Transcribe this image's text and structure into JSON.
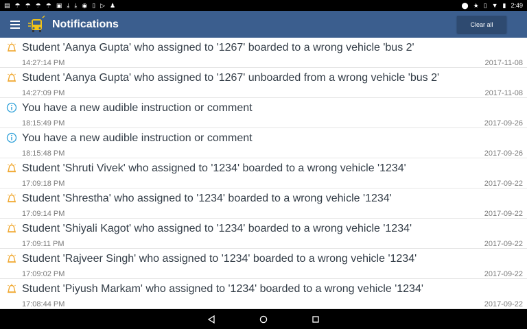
{
  "status_bar": {
    "time": "2:49",
    "left_icons": [
      "sms-icon",
      "weather-icon",
      "weather-icon",
      "weather-icon",
      "weather-icon",
      "image-icon",
      "download-icon",
      "download-icon",
      "nfc-icon",
      "sim-icon",
      "play-store-icon",
      "android-icon"
    ],
    "right_icons": [
      "location-icon",
      "star-icon",
      "vibrate-icon",
      "wifi-icon",
      "battery-icon"
    ]
  },
  "app_bar": {
    "title": "Notifications",
    "clear_label": "Clear all"
  },
  "colors": {
    "app_bar": "#3b5e8e",
    "button": "#2e4a70",
    "alert_icon": "#f0a830",
    "info_icon": "#2a9fd8",
    "message_text": "#333d47"
  },
  "notifications": [
    {
      "icon": "alert-icon",
      "message": "Student 'Aanya Gupta' who assigned to '1267' boarded to a wrong vehicle 'bus 2'",
      "time": "14:27:14 PM",
      "date": "2017-11-08"
    },
    {
      "icon": "alert-icon",
      "message": "Student 'Aanya Gupta' who assigned to '1267' unboarded from a wrong vehicle 'bus 2'",
      "time": "14:27:09 PM",
      "date": "2017-11-08"
    },
    {
      "icon": "info-icon",
      "message": "You have a new audible instruction or comment",
      "time": "18:15:49 PM",
      "date": "2017-09-26"
    },
    {
      "icon": "info-icon",
      "message": "You have a new audible instruction or comment",
      "time": "18:15:48 PM",
      "date": "2017-09-26"
    },
    {
      "icon": "alert-icon",
      "message": "Student 'Shruti Vivek' who assigned to '1234' boarded to a wrong vehicle '1234'",
      "time": "17:09:18 PM",
      "date": "2017-09-22"
    },
    {
      "icon": "alert-icon",
      "message": "Student 'Shrestha' who assigned to '1234' boarded to a wrong vehicle '1234'",
      "time": "17:09:14 PM",
      "date": "2017-09-22"
    },
    {
      "icon": "alert-icon",
      "message": "Student 'Shiyali Kagot' who assigned to '1234' boarded to a wrong vehicle '1234'",
      "time": "17:09:11 PM",
      "date": "2017-09-22"
    },
    {
      "icon": "alert-icon",
      "message": "Student 'Rajveer Singh' who assigned to '1234' boarded to a wrong vehicle '1234'",
      "time": "17:09:02 PM",
      "date": "2017-09-22"
    },
    {
      "icon": "alert-icon",
      "message": "Student 'Piyush Markam' who assigned to '1234' boarded to a wrong vehicle '1234'",
      "time": "17:08:44 PM",
      "date": "2017-09-22"
    }
  ],
  "nav_bar": {
    "buttons": [
      "back-icon",
      "home-icon",
      "recents-icon"
    ]
  }
}
